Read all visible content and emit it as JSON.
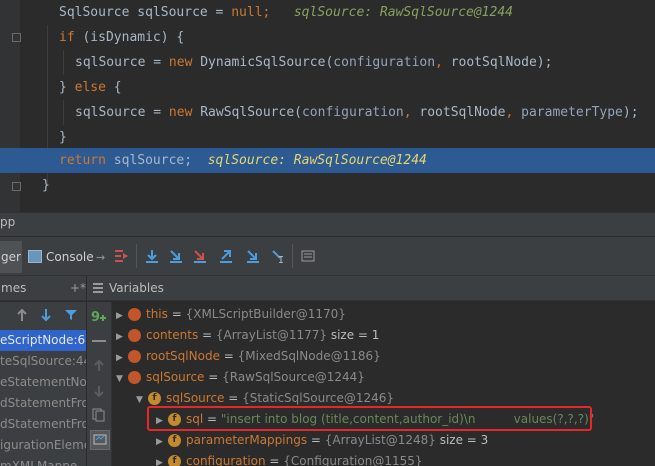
{
  "editor": {
    "lines": [
      {
        "kind": "decl",
        "type": "SqlSource",
        "var": "sqlSource",
        "eq": " = ",
        "val": "null",
        "semi": ";",
        "hint": "sqlSource: RawSqlSource@1244"
      },
      {
        "kind": "if",
        "kw": "if",
        "cond": " (isDynamic) {"
      },
      {
        "kind": "assign1",
        "lhs": "sqlSource = ",
        "kw": "new",
        "ctor": " DynamicSqlSource(",
        "p1": "configuration",
        "sep": ", ",
        "p2": "rootSqlNode",
        "end": ");"
      },
      {
        "kind": "else",
        "text": "} ",
        "kw": "else",
        "end": " {"
      },
      {
        "kind": "assign2",
        "lhs": "sqlSource = ",
        "kw": "new",
        "ctor": " RawSqlSource(",
        "p1": "configuration",
        "sep1": ", ",
        "p2": "rootSqlNode",
        "sep2": ", ",
        "p3": "parameterType",
        "end": ");"
      },
      {
        "kind": "close",
        "text": "}"
      },
      {
        "kind": "return",
        "kw": "return",
        "rest": " sqlSource;",
        "hint": "sqlSource: RawSqlSource@1244"
      },
      {
        "kind": "close0",
        "text": "}"
      }
    ]
  },
  "tool_header": "pp",
  "tabs": {
    "debugger": "ger",
    "console": "Console"
  },
  "frames": {
    "title": "mes",
    "pin": "+*",
    "items": [
      "eScriptNode:6",
      "teSqlSource:44",
      "eStatementNo",
      "dStatementFro",
      "dStatementFro",
      "igurationEleme",
      "mXMLMappe"
    ]
  },
  "variables": {
    "title": "Variables",
    "rows": [
      {
        "name": "this",
        "eq": " = ",
        "value": "{XMLScriptBuilder@1170}",
        "extra": ""
      },
      {
        "name": "contents",
        "eq": " = ",
        "value": "{ArrayList@1177}",
        "extra": "  size = 1"
      },
      {
        "name": "rootSqlNode",
        "eq": " = ",
        "value": "{MixedSqlNode@1186}",
        "extra": ""
      },
      {
        "name": "sqlSource",
        "eq": " = ",
        "value": "{RawSqlSource@1244}",
        "extra": ""
      },
      {
        "name": "sqlSource",
        "eq": " = ",
        "value": "{StaticSqlSource@1246}",
        "extra": "",
        "badge": "f"
      },
      {
        "name": "sql",
        "eq": " = ",
        "value": "\"insert into blog (title,content,author_id)\\n          values(?,?,?)\"",
        "extra": "",
        "badge": "f"
      },
      {
        "name": "parameterMappings",
        "eq": " = ",
        "value": "{ArrayList@1248}",
        "extra": "  size = 3",
        "badge": "f"
      },
      {
        "name": "configuration",
        "eq": " = ",
        "value": "{Configuration@1155}",
        "extra": "",
        "badge": "f"
      }
    ]
  },
  "colors": {
    "keyword": "#cc7832",
    "highlight": "#2d5a93",
    "hint_yellow": "#e8d56b",
    "hint_green": "#8aa05f",
    "selected_frame": "#2f65ca",
    "red_box": "#e62727"
  }
}
